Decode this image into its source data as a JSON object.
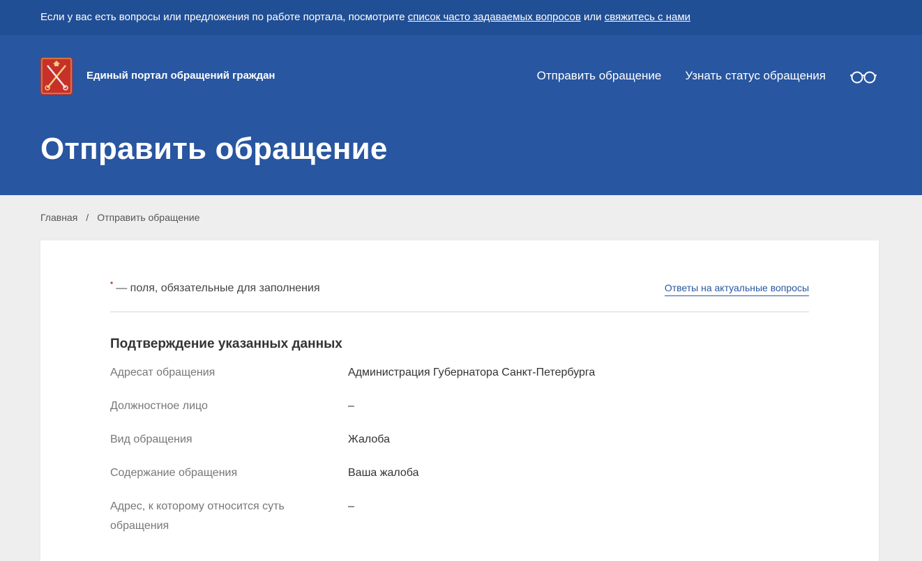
{
  "infobar": {
    "text_before": "Если у вас есть вопросы или предложения по работе портала, посмотрите ",
    "faq_link": "список часто задаваемых вопросов",
    "text_middle": " или ",
    "contact_link": "свяжитесь с нами"
  },
  "header": {
    "brand": "Единый портал обращений граждан",
    "nav": {
      "send": "Отправить обращение",
      "status": "Узнать статус обращения"
    },
    "page_title": "Отправить обращение"
  },
  "breadcrumb": {
    "home": "Главная",
    "separator": "/",
    "current": "Отправить обращение"
  },
  "form": {
    "required_dot": "•",
    "required_note": "— поля, обязательные для заполнения",
    "answers_link": "Ответы на актуальные вопросы",
    "section_title": "Подтверждение указанных данных",
    "rows": [
      {
        "label": "Адресат обращения",
        "value": "Администрация Губернатора Санкт-Петербурга"
      },
      {
        "label": "Должностное лицо",
        "value": "–"
      },
      {
        "label": "Вид обращения",
        "value": "Жалоба"
      },
      {
        "label": "Содержание обращения",
        "value": "Ваша жалоба"
      },
      {
        "label": "Адрес, к которому относится суть обращения",
        "value": "–"
      }
    ]
  },
  "colors": {
    "infobar_bg": "#214f95",
    "header_bg": "#2856a0",
    "page_bg": "#eeeeee",
    "required_dot": "#c0392b"
  }
}
